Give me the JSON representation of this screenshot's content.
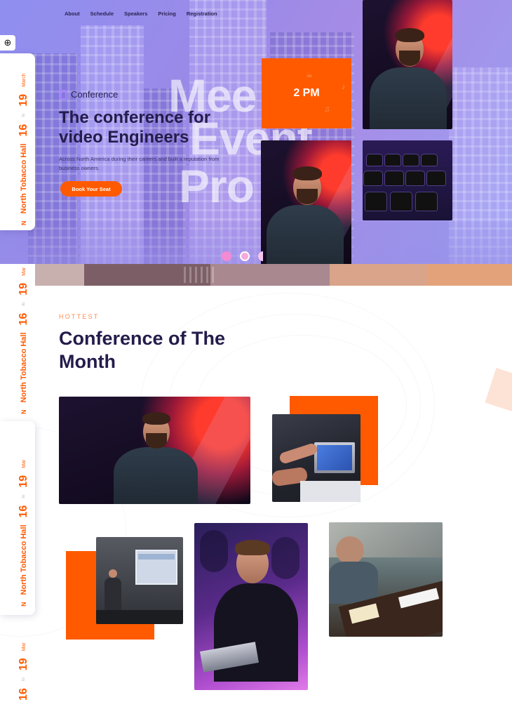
{
  "nav": [
    "About",
    "Schedule",
    "Speakers",
    "Pricing",
    "Registration"
  ],
  "hero": {
    "ghost_words": [
      "Mee",
      "Event",
      "Pro"
    ],
    "brand": "Conference",
    "title": "The conference for video Engineers",
    "description": "Across North America during their careers and built a reputation from business owners.",
    "cta": "Book Your Seat",
    "time": "2 PM",
    "slider_dots": 3,
    "active_dot": 2
  },
  "rail": {
    "month": "March",
    "month_short": "Mar",
    "day_end": "19",
    "to": "to",
    "day_start": "16",
    "venue": "North Tobacco Hall",
    "mark": "N"
  },
  "section": {
    "eyebrow": "HOTTEST",
    "title": "Conference of The Month"
  },
  "colors": {
    "accent": "#ff5a00",
    "heading": "#241c4b",
    "hero_overlay": "#9a8ae8",
    "dot": "#f38ad2"
  },
  "icons": [
    "lifebuoy-icon",
    "brand-mark-icon"
  ]
}
